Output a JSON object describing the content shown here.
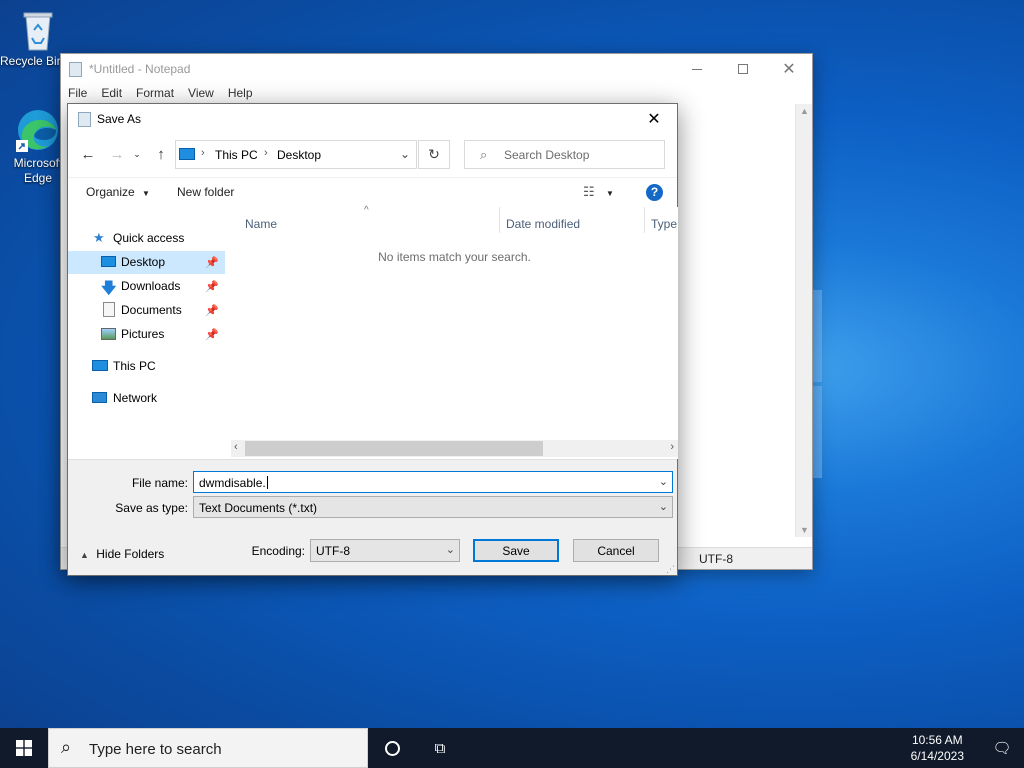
{
  "desktop": {
    "icons": [
      {
        "label": "Recycle Bin",
        "icon": "recycle-bin-icon"
      },
      {
        "label": "Microsoft Edge",
        "icon": "edge-icon"
      }
    ]
  },
  "notepad": {
    "title": "*Untitled - Notepad",
    "menu": [
      "File",
      "Edit",
      "Format",
      "View",
      "Help"
    ],
    "status_encoding": "UTF-8"
  },
  "dialog": {
    "title": "Save As",
    "address": {
      "segments": [
        "This PC",
        "Desktop"
      ]
    },
    "search_placeholder": "Search Desktop",
    "toolbar": {
      "organize": "Organize",
      "new_folder": "New folder"
    },
    "nav": [
      {
        "label": "Quick access",
        "icon": "star-icon"
      },
      {
        "label": "Desktop",
        "icon": "desktop-folder-icon",
        "pinned": true,
        "selected": true
      },
      {
        "label": "Downloads",
        "icon": "download-icon",
        "pinned": true
      },
      {
        "label": "Documents",
        "icon": "documents-icon",
        "pinned": true
      },
      {
        "label": "Pictures",
        "icon": "pictures-icon",
        "pinned": true
      },
      {
        "label": "This PC",
        "icon": "computer-icon"
      },
      {
        "label": "Network",
        "icon": "network-icon"
      }
    ],
    "columns": [
      "Name",
      "Date modified",
      "Type"
    ],
    "empty_message": "No items match your search.",
    "file_name_label": "File name:",
    "file_name_value": "dwmdisable.",
    "save_type_label": "Save as type:",
    "save_type_value": "Text Documents (*.txt)",
    "hide_folders": "Hide Folders",
    "encoding_label": "Encoding:",
    "encoding_value": "UTF-8",
    "save_button": "Save",
    "cancel_button": "Cancel"
  },
  "taskbar": {
    "search_placeholder": "Type here to search",
    "time": "10:56 AM",
    "date": "6/14/2023"
  },
  "colors": {
    "accent": "#0078d7",
    "selection": "#cce8ff",
    "taskbar": "#101a2a"
  }
}
